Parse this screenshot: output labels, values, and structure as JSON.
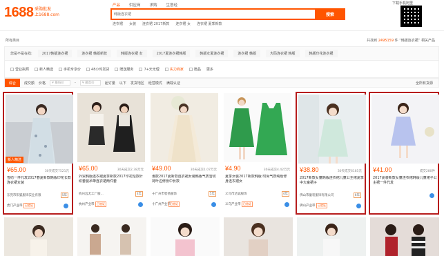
{
  "header": {
    "logo": "1688",
    "logo_sub_1": "采购批发",
    "logo_sub_2": "上1688.com",
    "search_tabs": [
      "产品",
      "供应商",
      "求购",
      "生意经"
    ],
    "search_placeholder": "韩版连衣裙",
    "search_button": "搜索",
    "hotwords": [
      "连衣裙",
      "女装",
      "连衣裙 2017新款",
      "连衣裙 女",
      "连衣裙 夏季新款"
    ],
    "qr_label": "下载手机阿里"
  },
  "category": {
    "all": "所有类目",
    "result_prefix": "共找到",
    "result_count": "2495159",
    "result_suffix": "件 “韩版连衣裙” 相关产品"
  },
  "filters": {
    "label": "您是不是在找:",
    "suggestions": [
      "2017韩版连衣裙",
      "连衣裙 韩版新款",
      "韩版连衣裙 女",
      "2017夏连衣裙韩版",
      "韩版女夏连衣裙",
      "连衣裙 韩版",
      "大码连衣裙 韩版",
      "韩版印花连衣裙"
    ],
    "checks": [
      {
        "label": "营业执照",
        "red": false
      },
      {
        "label": "新人精选",
        "red": false
      },
      {
        "label": "手机专享价",
        "red": false
      },
      {
        "label": "48小时发货",
        "red": false
      },
      {
        "label": "赠送服务",
        "red": false
      },
      {
        "label": "7+天无理",
        "red": false
      },
      {
        "label": "实力商家",
        "red": true
      },
      {
        "label": "赠品",
        "red": false
      },
      {
        "label": "更多",
        "red": false
      }
    ]
  },
  "sort": {
    "comprehensive": "综合",
    "volume": "成交额",
    "price": "价格",
    "price_min": "¥ 最低价",
    "price_max": "¥ 最高价",
    "start_batch": "起订量",
    "below": "以下",
    "ship_from": "发货地区",
    "operation_mode": "经营模式",
    "more": "满载认证",
    "shipping": "全所有货源"
  },
  "products": [
    {
      "price": "¥65.00",
      "sold": "30天成交7521元",
      "badge": "新人精选",
      "title": "雪纺一件代发2017春夏新款韩版印花长款连衣裙女装",
      "company": "东莞市阳狐服饰实业有限",
      "years": "5年",
      "location": "虎门产业带",
      "mini": "已验证",
      "highlighted": true
    },
    {
      "price": "¥65.00",
      "sold": "30天成交2.38万元",
      "badge": "",
      "title": "外贸韩版连衣裙夏季新款2017印花短款针织套装吊带连衣裙两件套",
      "company": "杭州远尤工厂服...",
      "years": "3年",
      "location": "杭州产业带",
      "mini": "已验证",
      "highlighted": false
    },
    {
      "price": "¥49.00",
      "sold": "30天成交1.07万元",
      "badge": "",
      "title": "潮款2017夏新款连衣裙女装韩版气质雪纺荷叶边修身中长款",
      "company": "十广州市智扬服饰",
      "years": "5年",
      "location": "十广州产业带",
      "mini": "已验证",
      "highlighted": false
    },
    {
      "price": "¥4.90",
      "sold": "30天成交4.42万元",
      "badge": "",
      "title": "夏季女装2017新款韩版 时尚气质纯色修身连衣裙女",
      "company": "义乌市达诚服饰",
      "years": "4年",
      "location": "义乌产业带",
      "mini": "已验证",
      "highlighted": false
    },
    {
      "price": "¥38.80",
      "sold": "30天成交6185元",
      "badge": "",
      "title": "2017新款女童韩版连衣裙儿童公主裙夏季中大童裙子",
      "company": "佛山市童装服饰有限公司",
      "years": "6年",
      "location": "佛山产业带",
      "mini": "已验证",
      "highlighted": true
    },
    {
      "price": "¥41.00",
      "sold": "成交280件",
      "badge": "",
      "title": "2017夏装新款女童连衣裙韩版儿童裙子公主裙一件代发",
      "company": "",
      "years": "",
      "location": "",
      "mini": "",
      "highlighted": true
    }
  ],
  "colors": {
    "accent": "#ff5500",
    "highlight_border": "#b71c1c"
  }
}
